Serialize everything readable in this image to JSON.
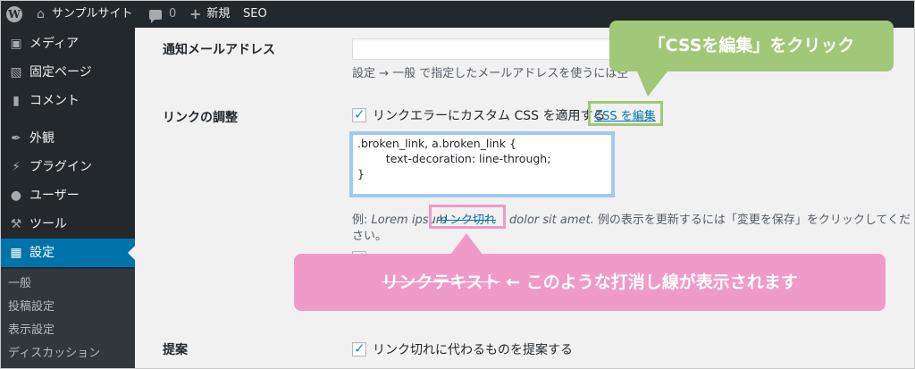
{
  "adminbar": {
    "site_name": "サンプルサイト",
    "comment_count": "0",
    "new_label": "新規",
    "seo_label": "SEO"
  },
  "sidebar": {
    "items": [
      {
        "label": "メディア",
        "icon": "media-icon"
      },
      {
        "label": "固定ページ",
        "icon": "page-icon"
      },
      {
        "label": "コメント",
        "icon": "comment-icon"
      },
      {
        "label": "外観",
        "icon": "brush-icon"
      },
      {
        "label": "プラグイン",
        "icon": "plugin-icon"
      },
      {
        "label": "ユーザー",
        "icon": "user-icon"
      },
      {
        "label": "ツール",
        "icon": "wrench-icon"
      },
      {
        "label": "設定",
        "icon": "settings-icon"
      }
    ],
    "submenu": [
      "一般",
      "投稿設定",
      "表示設定",
      "ディスカッション"
    ]
  },
  "main": {
    "email_label": "通知メールアドレス",
    "email_value": "",
    "email_desc": "設定 → 一般 で指定したメールアドレスを使うには空",
    "link_label": "リンクの調整",
    "custom_css_option": "リンクエラーにカスタム CSS を適用する",
    "edit_css_link": "CSS を編集",
    "css_lines": [
      ".broken_link, a.broken_link {",
      "        text-decoration: line-through;",
      "}"
    ],
    "example_prefix": "例: ",
    "example_italic": "Lorem ipsum",
    "example_link": "リンク切れ",
    "example_italic2": "dolor sit amet.",
    "example_suffix": " 例の表示を更新するには「変更を保存」をクリックしてくだ",
    "example_suffix2": "さい。",
    "suggest_label": "提案",
    "suggest_option": "リンク切れに代わるものを提案する"
  },
  "annotations": {
    "green_callout": "「CSSを編集」をクリック",
    "pink_callout_strike": "リンクテキスト",
    "pink_callout_text": " ← このような打消し線が表示されます",
    "green_color": "#a0c878",
    "pink_color": "#f09ac8",
    "blue_box_color": "#a3c9ee"
  }
}
